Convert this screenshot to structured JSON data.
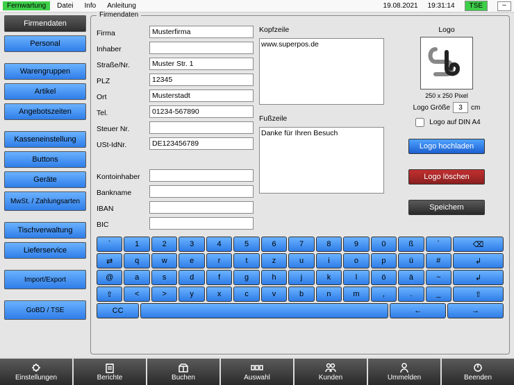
{
  "menubar": {
    "fernwartung": "Fernwartung",
    "items": [
      "Datei",
      "Info",
      "Anleitung"
    ],
    "date": "19.08.2021",
    "time": "19:31:14",
    "tse": "TSE"
  },
  "sidebar": {
    "items": [
      {
        "label": "Firmendaten",
        "dark": true
      },
      {
        "label": "Personal"
      },
      {
        "label": "Warengruppen"
      },
      {
        "label": "Artikel"
      },
      {
        "label": "Angebotszeiten"
      },
      {
        "label": "Kasseneinstellung"
      },
      {
        "label": "Buttons"
      },
      {
        "label": "Geräte"
      },
      {
        "label": "MwSt. / Zahlungsarten"
      },
      {
        "label": "Tischverwaltung"
      },
      {
        "label": "Lieferservice"
      },
      {
        "label": "Import/Export"
      },
      {
        "label": "GoBD / TSE"
      }
    ]
  },
  "panel": {
    "title": "Firmendaten",
    "labels": {
      "firma": "Firma",
      "inhaber": "Inhaber",
      "strasse": "Straße/Nr.",
      "plz": "PLZ",
      "ort": "Ort",
      "tel": "Tel.",
      "steuer": "Steuer Nr.",
      "ust": "USt-IdNr.",
      "kontoinhaber": "Kontoinhaber",
      "bankname": "Bankname",
      "iban": "IBAN",
      "bic": "BIC"
    },
    "values": {
      "firma": "Musterfirma",
      "inhaber": "",
      "strasse": "Muster Str. 1",
      "plz": "12345",
      "ort": "Musterstadt",
      "tel": "01234-567890",
      "steuer": "",
      "ust": "DE123456789",
      "kontoinhaber": "",
      "bankname": "",
      "iban": "",
      "bic": ""
    },
    "kopfzeile_label": "Kopfzeile",
    "kopfzeile": "www.superpos.de",
    "fusszeile_label": "Fußzeile",
    "fusszeile": "Danke für Ihren Besuch",
    "logo_caption": "Logo",
    "logo_dim": "250 x 250 Pixel",
    "logo_size_label": "Logo Größe",
    "logo_size_value": "3",
    "logo_size_unit": "cm",
    "logo_dina4": "Logo auf DIN A4",
    "btn_upload": "Logo hochladen",
    "btn_delete": "Logo löschen",
    "btn_save": "Speichern"
  },
  "keyboard": {
    "r1": [
      "`",
      "1",
      "2",
      "3",
      "4",
      "5",
      "6",
      "7",
      "8",
      "9",
      "0",
      "ß",
      "´"
    ],
    "r2": [
      "q",
      "w",
      "e",
      "r",
      "t",
      "z",
      "u",
      "i",
      "o",
      "p",
      "ü",
      "#"
    ],
    "r3": [
      "@",
      "a",
      "s",
      "d",
      "f",
      "g",
      "h",
      "j",
      "k",
      "l",
      "ö",
      "ä",
      "~"
    ],
    "r4": [
      "<",
      ">",
      "y",
      "x",
      "c",
      "v",
      "b",
      "n",
      "m",
      ",",
      ".",
      "_"
    ],
    "r5": [
      "CC"
    ],
    "tab": "⇄",
    "shift": "⇧",
    "bksp": "⌫",
    "enter1": "↲",
    "enter2": "↲",
    "left": "←",
    "right": "→"
  },
  "bottombar": {
    "items": [
      "Einstellungen",
      "Berichte",
      "Buchen",
      "Auswahl",
      "Kunden",
      "Ummelden",
      "Beenden"
    ]
  }
}
